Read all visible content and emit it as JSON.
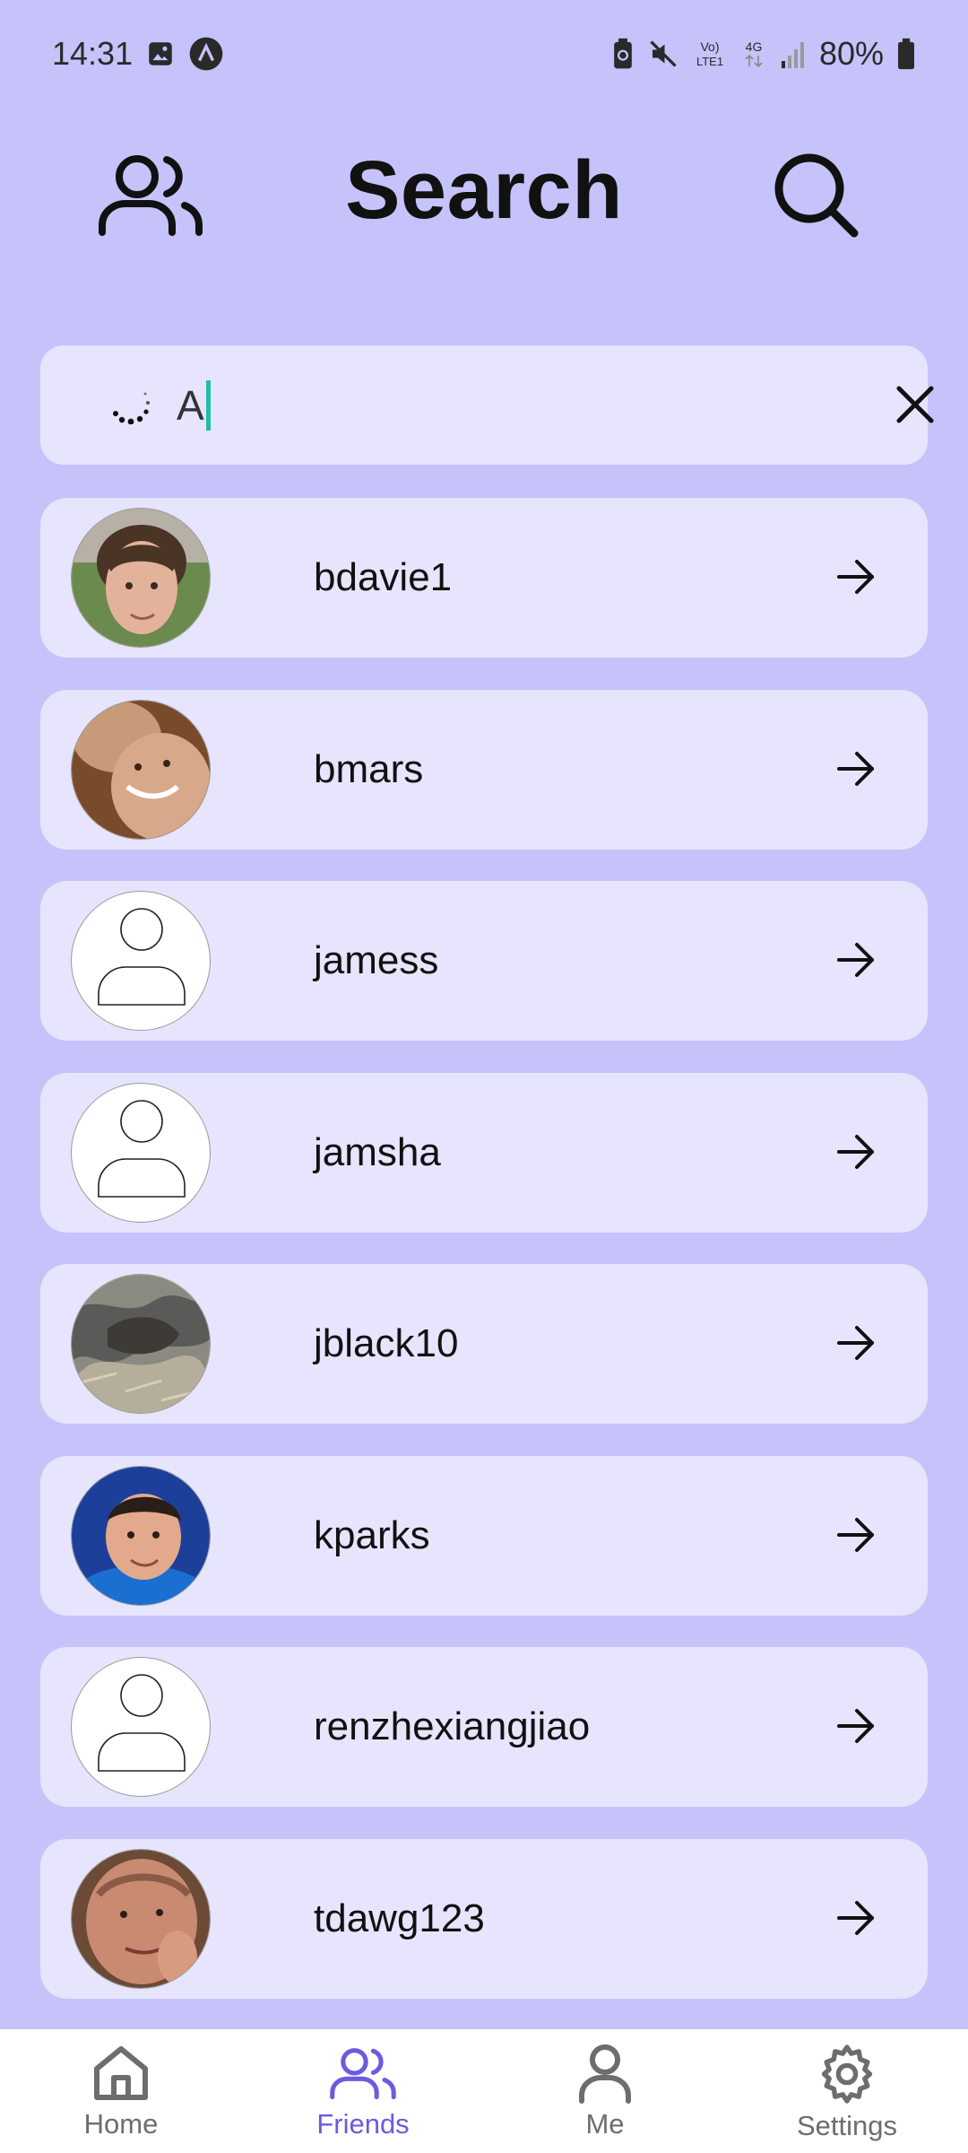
{
  "status_bar": {
    "time": "14:31",
    "battery": "80%",
    "network": "4G",
    "icons_left": [
      "gallery-icon",
      "app-notification-icon"
    ],
    "icons_right": [
      "battery-saver-icon",
      "mute-icon",
      "volte-icon",
      "network-4g-icon",
      "signal-icon",
      "battery-icon"
    ]
  },
  "header": {
    "title": "Search",
    "left_icon": "friends-icon",
    "right_icon": "search-icon"
  },
  "search": {
    "value": "A",
    "loading": true
  },
  "results": [
    {
      "username": "bdavie1",
      "avatar": "photo"
    },
    {
      "username": "bmars",
      "avatar": "photo"
    },
    {
      "username": "jamess",
      "avatar": "placeholder"
    },
    {
      "username": "jamsha",
      "avatar": "placeholder"
    },
    {
      "username": "jblack10",
      "avatar": "photo"
    },
    {
      "username": "kparks",
      "avatar": "photo"
    },
    {
      "username": "renzhexiangjiao",
      "avatar": "placeholder"
    },
    {
      "username": "tdawg123",
      "avatar": "photo"
    }
  ],
  "bottom_nav": [
    {
      "label": "Home",
      "icon": "home-icon",
      "active": false
    },
    {
      "label": "Friends",
      "icon": "friends-icon",
      "active": true
    },
    {
      "label": "Me",
      "icon": "person-icon",
      "active": false
    },
    {
      "label": "Settings",
      "icon": "gear-icon",
      "active": false
    }
  ],
  "colors": {
    "background": "#c5c3fa",
    "card": "#e6e5fd",
    "accent": "#6a5be0",
    "caret": "#1dbfa6"
  }
}
